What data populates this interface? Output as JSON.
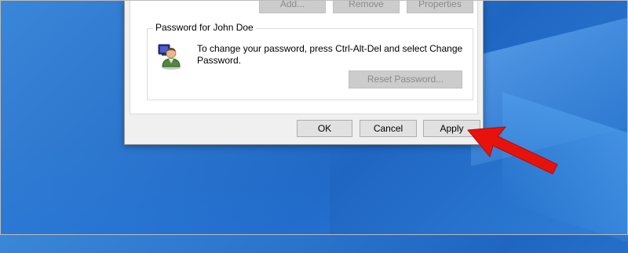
{
  "dialog": {
    "top_buttons": [
      {
        "label": "Add..."
      },
      {
        "label": "Remove"
      },
      {
        "label": "Properties"
      }
    ],
    "password_group": {
      "title": "Password for John Doe",
      "message": "To change your password, press Ctrl-Alt-Del and select Change Password.",
      "icon": "user-icon",
      "reset_button": "Reset Password..."
    },
    "footer": {
      "ok": "OK",
      "cancel": "Cancel",
      "apply": "Apply"
    }
  },
  "annotation": {
    "type": "arrow",
    "color": "#e8120c",
    "points_to": "apply-button"
  }
}
